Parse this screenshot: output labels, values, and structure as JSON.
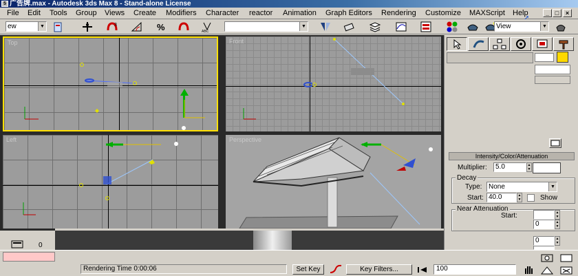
{
  "window": {
    "title": "广告牌.max - Autodesk 3ds Max 8  - Stand-alone License",
    "icon_label": "5",
    "controls": [
      "_",
      "□",
      "×"
    ]
  },
  "menubar": {
    "items": [
      "File",
      "Edit",
      "Tools",
      "Group",
      "Views",
      "Create",
      "Modifiers",
      "Character",
      "reactor",
      "Animation",
      "Graph Editors",
      "Rendering",
      "Customize",
      "MAXScript",
      "Help"
    ],
    "mnemonics": [
      "F",
      "E",
      "T",
      "G",
      "V",
      "C",
      "M",
      "h",
      "r",
      "A",
      "G",
      "R",
      "u",
      "M",
      "H"
    ],
    "doc_controls": [
      "_",
      "□",
      "×"
    ]
  },
  "toolbar": {
    "selection_filter_value": "ew",
    "named_selection_value": "",
    "reference_coord_value": "View"
  },
  "viewports": {
    "top_left_label": "Top",
    "top_right_label": "Front",
    "bottom_left_label": "Left",
    "bottom_right_label": "Perspective"
  },
  "command_panel": {
    "rollout_title": "Intensity/Color/Attenuation",
    "multiplier_label": "Multiplier:",
    "multiplier_value": "5.0",
    "decay_group_title": "Decay",
    "type_label": "Type:",
    "type_value": "None",
    "start_label": "Start:",
    "start_value": "40.0",
    "show_label": "Show",
    "near_atten_title": "Near Attenuation",
    "near_start_label": "Start:",
    "near_start_value": "0",
    "extra_value_1": "0",
    "extra_value_2": "0",
    "accent_color": "#ffd800"
  },
  "statusbar": {
    "frame_value": "0",
    "rendering_time_label": "Rendering Time  0:00:06",
    "set_key_label": "Set Key",
    "key_filters_label": "Key Filters...",
    "frame_field_value": "100"
  }
}
